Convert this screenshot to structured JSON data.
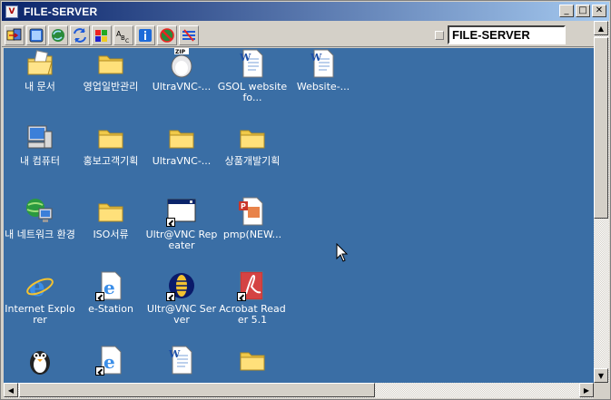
{
  "window": {
    "title": "FILE-SERVER",
    "title_icon_glyph": "V",
    "minimize_glyph": "_",
    "maximize_glyph": "□",
    "close_glyph": "✕"
  },
  "toolbar": {
    "host": "FILE-SERVER",
    "tools": [
      "send-ctrl-alt-del-icon",
      "fullscreen-icon",
      "refresh-screen-icon",
      "file-transfer-icon",
      "chat-icon",
      "text-mode-icon",
      "info-icon",
      "disconnect-icon",
      "options-icon"
    ]
  },
  "scrollbars": {
    "up": "▲",
    "down": "▼",
    "left": "◀",
    "right": "▶"
  },
  "desktop": {
    "background": "#3a6ea5",
    "icons": [
      {
        "label": "내 문서",
        "type": "my-documents"
      },
      {
        "label": "영업일반관리",
        "type": "folder"
      },
      {
        "label": "UltraVNC-...",
        "type": "zip"
      },
      {
        "label": "GSOL website fo...",
        "type": "word"
      },
      {
        "label": "Website-...",
        "type": "word"
      },
      {
        "label": "내 컴퓨터",
        "type": "my-computer"
      },
      {
        "label": "홍보고객기획",
        "type": "folder"
      },
      {
        "label": "UltraVNC-...",
        "type": "folder"
      },
      {
        "label": "상품개발기획",
        "type": "folder"
      },
      {
        "label": "내 네트워크 환경",
        "type": "network"
      },
      {
        "label": "ISO서류",
        "type": "folder"
      },
      {
        "label": "Ultr@VNC Repeater",
        "type": "app-window"
      },
      {
        "label": "pmp(NEW...",
        "type": "ppt"
      },
      {
        "label": "Internet Explorer",
        "type": "ie"
      },
      {
        "label": "e-Station",
        "type": "ie-shortcut"
      },
      {
        "label": "Ultr@VNC Server",
        "type": "vnc"
      },
      {
        "label": "Acrobat Reader 5.1",
        "type": "acrobat"
      },
      {
        "label": "",
        "type": "penguin"
      },
      {
        "label": "",
        "type": "ie-shortcut"
      },
      {
        "label": "",
        "type": "word"
      },
      {
        "label": "",
        "type": "folder"
      }
    ]
  }
}
